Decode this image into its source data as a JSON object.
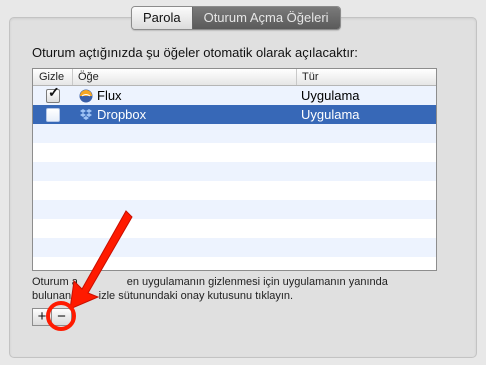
{
  "tabs": [
    {
      "label": "Parola",
      "active": false
    },
    {
      "label": "Oturum Açma Öğeleri",
      "active": true
    }
  ],
  "description": "Oturum açtığınızda şu öğeler otomatik olarak açılacaktır:",
  "table": {
    "headers": {
      "hide": "Gizle",
      "item": "Öğe",
      "type": "Tür"
    },
    "rows": [
      {
        "hidden": true,
        "name": "Flux",
        "type": "Uygulama",
        "selected": false,
        "icon": "flux-icon"
      },
      {
        "hidden": false,
        "name": "Dropbox",
        "type": "Uygulama",
        "selected": true,
        "icon": "dropbox-icon"
      }
    ]
  },
  "bottom_text_line1": "Oturum a                en uygulamanın gizlenmesi için uygulamanın yanında",
  "bottom_text_line2": "bulunan         izle sütunundaki onay kutusunu tıklayın.",
  "buttons": {
    "add": "+",
    "remove": "−"
  },
  "annotation": {
    "color": "#ff1a00"
  }
}
